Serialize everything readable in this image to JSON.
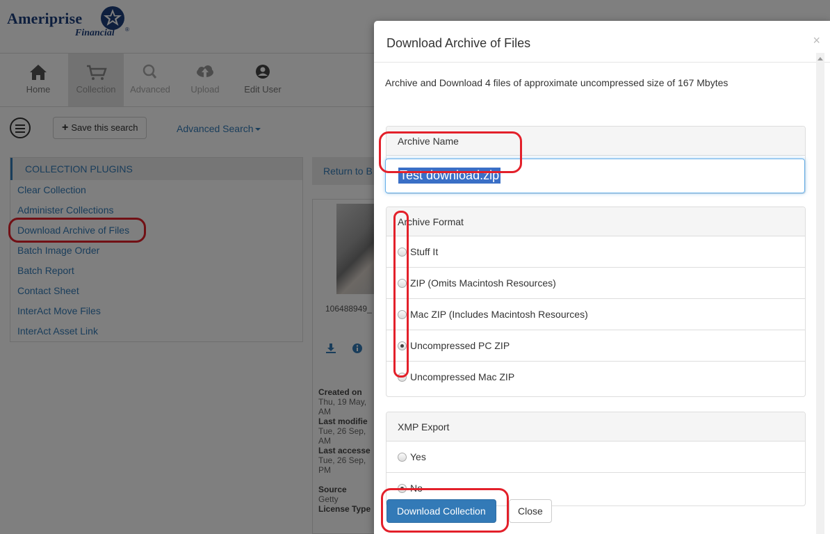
{
  "app": {
    "brand": "Ameriprise",
    "brand_sub": "Financial",
    "brand_mark": "®"
  },
  "nav": {
    "items": [
      {
        "label": "Home",
        "icon": "home-icon"
      },
      {
        "label": "Collection",
        "icon": "cart-icon",
        "active": true
      },
      {
        "label": "Advanced",
        "icon": "search-icon"
      },
      {
        "label": "Upload",
        "icon": "cloud-upload-icon"
      },
      {
        "label": "Edit User",
        "icon": "user-circle-icon"
      }
    ]
  },
  "toolbar": {
    "save_search_label": "Save this search",
    "advanced_search_label": "Advanced Search"
  },
  "plugins": {
    "header": "COLLECTION PLUGINS",
    "items": [
      "Clear Collection",
      "Administer Collections",
      "Download Archive of Files",
      "Batch Image Order",
      "Batch Report",
      "Contact Sheet",
      "InterAct Move Files",
      "InterAct Asset Link"
    ]
  },
  "main": {
    "return_label": "Return to B",
    "file_name": "106488949_",
    "meta": {
      "created_label": "Created on",
      "created_value": "Thu, 19 May, ",
      "created_ampm": "AM",
      "modified_label": "Last modifie",
      "modified_value": "Tue, 26 Sep, ",
      "modified_ampm": "AM",
      "accessed_label": "Last accesse",
      "accessed_value": "Tue, 26 Sep, ",
      "accessed_ampm": "PM",
      "source_label": "Source",
      "source_value": "Getty",
      "license_label": "License Type"
    }
  },
  "modal": {
    "title": "Download Archive of Files",
    "close_glyph": "×",
    "intro": "Archive and Download 4 files of approximate uncompressed size of 167 Mbytes",
    "archive_name_label": "Archive Name",
    "archive_name_value": "Test download.zip",
    "format_label": "Archive Format",
    "formats": [
      {
        "label": "Stuff It",
        "checked": false
      },
      {
        "label": "ZIP (Omits Macintosh Resources)",
        "checked": false
      },
      {
        "label": "Mac ZIP (Includes Macintosh Resources)",
        "checked": false
      },
      {
        "label": "Uncompressed PC ZIP",
        "checked": true
      },
      {
        "label": "Uncompressed Mac ZIP",
        "checked": false
      }
    ],
    "xmp_label": "XMP Export",
    "xmp_options": [
      {
        "label": "Yes",
        "checked": false
      },
      {
        "label": "No",
        "checked": true
      }
    ],
    "download_button": "Download Collection",
    "close_button": "Close"
  },
  "colors": {
    "primary": "#337ab7",
    "brand": "#1c3f7d",
    "annotation": "#e3202a"
  }
}
